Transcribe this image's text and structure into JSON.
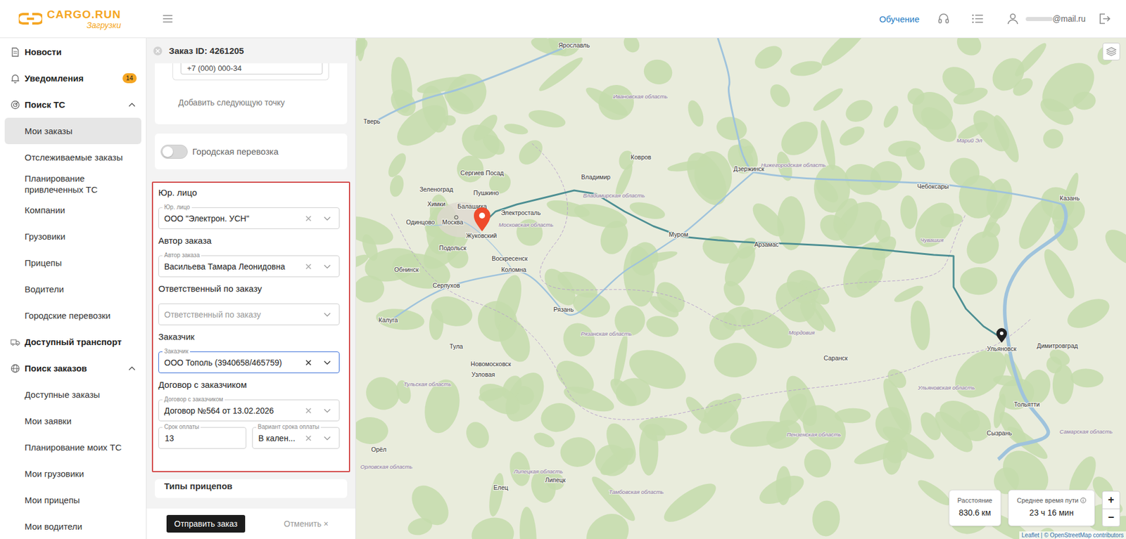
{
  "header": {
    "logo": {
      "name": "CARGO.RUN",
      "tagline": "Загрузки"
    },
    "training": "Обучение",
    "user": "@mail.ru"
  },
  "sidebar": {
    "items": [
      {
        "label": "Новости",
        "kind": "link",
        "selected": false
      },
      {
        "label": "Уведомления",
        "kind": "link",
        "selected": false,
        "badge": "14"
      },
      {
        "label": "Поиск ТС",
        "kind": "group",
        "expanded": true,
        "selected": false
      },
      {
        "label": "Мои заказы",
        "kind": "sub",
        "selected": true
      },
      {
        "label": "Отслеживаемые заказы",
        "kind": "sub",
        "selected": false
      },
      {
        "label": "Планирование привлеченных ТС",
        "kind": "sub",
        "selected": false
      },
      {
        "label": "Компании",
        "kind": "sub",
        "selected": false
      },
      {
        "label": "Грузовики",
        "kind": "sub",
        "selected": false
      },
      {
        "label": "Прицепы",
        "kind": "sub",
        "selected": false
      },
      {
        "label": "Водители",
        "kind": "sub",
        "selected": false
      },
      {
        "label": "Городские перевозки",
        "kind": "sub",
        "selected": false
      },
      {
        "label": "Доступный транспорт",
        "kind": "link",
        "selected": false
      },
      {
        "label": "Поиск заказов",
        "kind": "group",
        "expanded": true,
        "selected": false
      },
      {
        "label": "Доступные заказы",
        "kind": "sub",
        "selected": false
      },
      {
        "label": "Мои заявки",
        "kind": "sub",
        "selected": false
      },
      {
        "label": "Планирование моих ТС",
        "kind": "sub",
        "selected": false
      },
      {
        "label": "Мои грузовики",
        "kind": "sub",
        "selected": false
      },
      {
        "label": "Мои прицепы",
        "kind": "sub",
        "selected": false
      },
      {
        "label": "Мои водители",
        "kind": "sub",
        "selected": false
      }
    ]
  },
  "order": {
    "title": "Заказ ID: 4261205",
    "phone": "+7 (000) 000-34",
    "add_point": "Добавить следующую точку",
    "city_toggle": {
      "label": "Городская перевозка",
      "on": false
    },
    "sections": [
      {
        "title": "Юр. лицо",
        "field": {
          "label": "Юр. лицо",
          "value": "ООО \"Электрон. УСН\"",
          "focused": false,
          "clearable": true
        }
      },
      {
        "title": "Автор заказа",
        "field": {
          "label": "Автор заказа",
          "value": "Васильева Тамара Леонидовна",
          "focused": false,
          "clearable": true
        }
      },
      {
        "title": "Ответственный по заказу",
        "field": {
          "placeholder": "Ответственный по заказу",
          "focused": false,
          "clearable": false
        }
      },
      {
        "title": "Заказчик",
        "field": {
          "label": "Заказчик",
          "value": "ООО Тополь (3940658/465759)",
          "focused": true,
          "clearable": true
        }
      },
      {
        "title": "Договор с заказчиком",
        "field": {
          "label": "Договор с заказчиком",
          "value": "Договор №564 от 13.02.2026",
          "focused": false,
          "clearable": true
        }
      }
    ],
    "payment": [
      {
        "label": "Срок оплаты",
        "value": "13",
        "focused": false,
        "clearable": false
      },
      {
        "label": "Вариант срока оплаты",
        "value": "В кален...",
        "focused": false,
        "clearable": true
      }
    ],
    "next_section": "Типы прицепов",
    "submit": "Отправить заказ",
    "cancel": "Отменить ×"
  },
  "map": {
    "labels": [
      {
        "text": "Тверь",
        "kind": "city"
      },
      {
        "text": "Ярославль",
        "kind": "city"
      },
      {
        "text": "Ивановская область",
        "kind": "region"
      },
      {
        "text": "Сергиев Посад",
        "kind": "city"
      },
      {
        "text": "Зеленоград",
        "kind": "city"
      },
      {
        "text": "Пушкино",
        "kind": "city"
      },
      {
        "text": "Химки",
        "kind": "city"
      },
      {
        "text": "Балашиха",
        "kind": "city"
      },
      {
        "text": "Электросталь",
        "kind": "city"
      },
      {
        "text": "Одинцово",
        "kind": "city"
      },
      {
        "text": "Москва",
        "kind": "city"
      },
      {
        "text": "Жуковский",
        "kind": "city"
      },
      {
        "text": "Московская область",
        "kind": "region"
      },
      {
        "text": "Подольск",
        "kind": "city"
      },
      {
        "text": "Воскресенск",
        "kind": "city"
      },
      {
        "text": "Коломна",
        "kind": "city"
      },
      {
        "text": "Обнинск",
        "kind": "city"
      },
      {
        "text": "Серпухов",
        "kind": "city"
      },
      {
        "text": "Калуга",
        "kind": "city"
      },
      {
        "text": "Рязань",
        "kind": "city"
      },
      {
        "text": "Тула",
        "kind": "city"
      },
      {
        "text": "Новомосковск",
        "kind": "city"
      },
      {
        "text": "Узловая",
        "kind": "city"
      },
      {
        "text": "Тульская область",
        "kind": "region"
      },
      {
        "text": "Рязанская область",
        "kind": "region"
      },
      {
        "text": "Владимир",
        "kind": "city"
      },
      {
        "text": "Владимирская область",
        "kind": "region"
      },
      {
        "text": "Ковров",
        "kind": "city"
      },
      {
        "text": "Дзержинск",
        "kind": "city"
      },
      {
        "text": "Нижегородская область",
        "kind": "region"
      },
      {
        "text": "Муром",
        "kind": "city"
      },
      {
        "text": "Арзамас",
        "kind": "city"
      },
      {
        "text": "Чебоксары",
        "kind": "city"
      },
      {
        "text": "Марий Эл",
        "kind": "region"
      },
      {
        "text": "Чувашия",
        "kind": "region"
      },
      {
        "text": "Казань",
        "kind": "city"
      },
      {
        "text": "Мордовия",
        "kind": "region"
      },
      {
        "text": "Саранск",
        "kind": "city"
      },
      {
        "text": "Ульяновск",
        "kind": "city"
      },
      {
        "text": "Димитровград",
        "kind": "city"
      },
      {
        "text": "Ульяновская область",
        "kind": "region"
      },
      {
        "text": "Пензенская область",
        "kind": "region"
      },
      {
        "text": "Тольятти",
        "kind": "city"
      },
      {
        "text": "Сызрань",
        "kind": "city"
      },
      {
        "text": "Самарская область",
        "kind": "region"
      },
      {
        "text": "Липецкая область",
        "kind": "region"
      },
      {
        "text": "Орловская область",
        "kind": "region"
      },
      {
        "text": "Орёл",
        "kind": "city"
      },
      {
        "text": "Липецк",
        "kind": "city"
      },
      {
        "text": "Елец",
        "kind": "city"
      },
      {
        "text": "Тамбовская область",
        "kind": "region"
      }
    ],
    "distance": {
      "label": "Расстояние",
      "value": "830.6 км"
    },
    "duration": {
      "label": "Среднее время пути",
      "value": "23 ч 16 мин"
    },
    "zoom_in": "+",
    "zoom_out": "−",
    "attribution": "Leaflet | © OpenStreetMap contributors"
  }
}
